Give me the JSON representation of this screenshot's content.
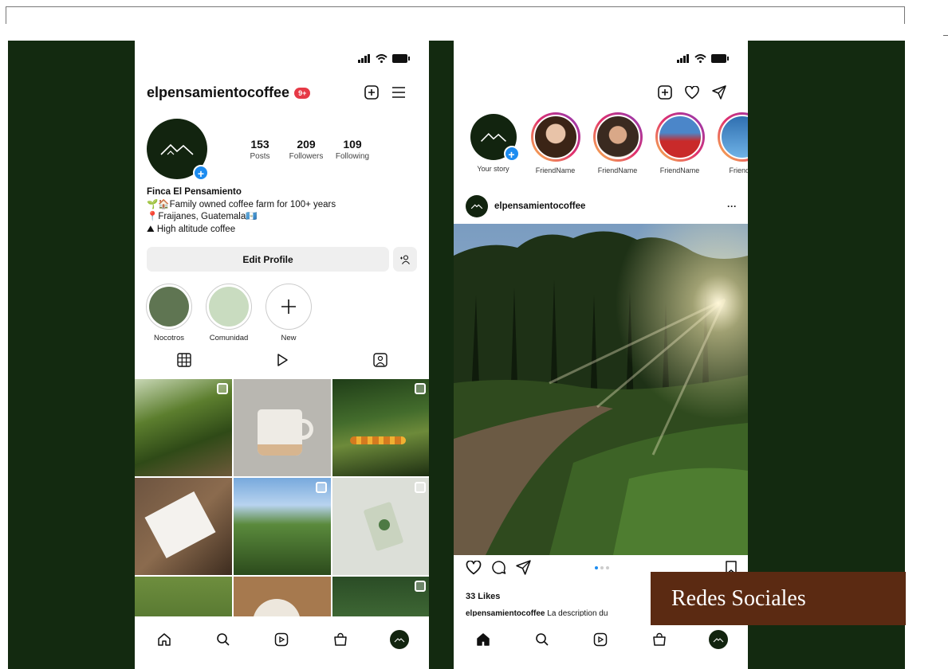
{
  "colors": {
    "background": "#132a10",
    "brand": "#12240f",
    "accent": "#1d8cf0",
    "label_bg": "#5b2a12"
  },
  "profile": {
    "handle": "elpensamientocoffee",
    "notif_badge": "9+",
    "stats": [
      {
        "value": "153",
        "label": "Posts"
      },
      {
        "value": "209",
        "label": "Followers"
      },
      {
        "value": "109",
        "label": "Following"
      }
    ],
    "bio": {
      "name": "Finca El Pensamiento",
      "line1": "🌱🏠Family owned coffee farm for 100+ years",
      "line2": "📍Fraijanes, Guatemala🇬🇹",
      "line3": "⛰ High altitude coffee"
    },
    "edit_label": "Edit Profile",
    "highlights": [
      {
        "label": "Nocotros",
        "color": "#5f7552"
      },
      {
        "label": "Comunidad",
        "color": "#c9dcc0"
      },
      {
        "label": "New",
        "color": "#ffffff"
      }
    ],
    "icons": [
      "plus-square-icon",
      "menu-icon",
      "grid-icon",
      "reels-icon",
      "tagged-icon"
    ]
  },
  "feed": {
    "stories": [
      {
        "label": "Your story"
      },
      {
        "label": "FriendName"
      },
      {
        "label": "FriendName"
      },
      {
        "label": "FriendName"
      },
      {
        "label": "FriendN"
      }
    ],
    "post_author": "elpensamientocoffee",
    "more": "···",
    "likes": "33 Likes",
    "caption_user": "elpensamientocoffee",
    "caption_text": " La description du",
    "icons": [
      "plus-square-icon",
      "heart-icon",
      "send-icon",
      "like-icon",
      "comment-icon",
      "share-icon",
      "bookmark-icon"
    ]
  },
  "nav_icons": [
    "home-icon",
    "search-icon",
    "reels-icon",
    "shop-icon",
    "profile-avatar"
  ],
  "overlay_label": "Redes Sociales"
}
